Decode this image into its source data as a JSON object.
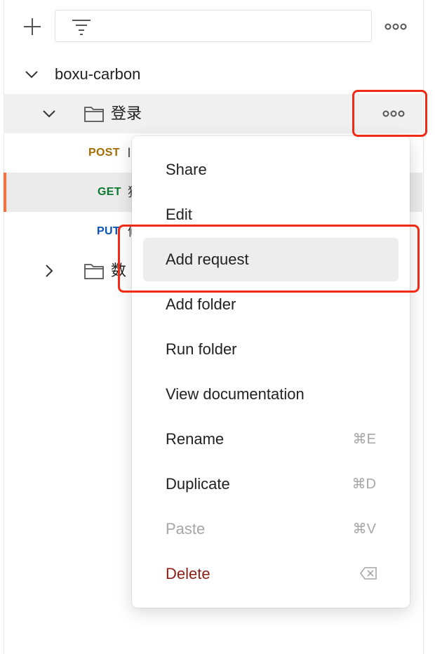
{
  "colors": {
    "accent": "#ff6c37",
    "highlight": "#f02a14",
    "post": "#a36c00",
    "get": "#0b7a2f",
    "put": "#0a52b5",
    "danger": "#8b1e16"
  },
  "toolbar": {
    "add_icon": "plus-icon",
    "filter_icon": "filter-icon",
    "more_icon": "more-horizontal-icon"
  },
  "tree": {
    "collection": {
      "name": "boxu-carbon",
      "expanded": true
    },
    "folders": [
      {
        "name": "登录",
        "expanded": true,
        "requests": [
          {
            "method": "POST",
            "name": "l"
          },
          {
            "method": "GET",
            "name": "獲",
            "active": true
          },
          {
            "method": "PUT",
            "name": "修"
          }
        ]
      },
      {
        "name": "数",
        "expanded": false
      }
    ]
  },
  "context_menu": {
    "items": [
      {
        "label": "Share",
        "shortcut": ""
      },
      {
        "label": "Edit",
        "shortcut": ""
      },
      {
        "label": "Add request",
        "shortcut": "",
        "hovered": true
      },
      {
        "label": "Add folder",
        "shortcut": ""
      },
      {
        "label": "Run folder",
        "shortcut": ""
      },
      {
        "label": "View documentation",
        "shortcut": ""
      },
      {
        "label": "Rename",
        "shortcut": "⌘E"
      },
      {
        "label": "Duplicate",
        "shortcut": "⌘D"
      },
      {
        "label": "Paste",
        "shortcut": "⌘V",
        "disabled": true
      },
      {
        "label": "Delete",
        "shortcut_icon": "backspace-icon",
        "danger": true
      }
    ]
  }
}
